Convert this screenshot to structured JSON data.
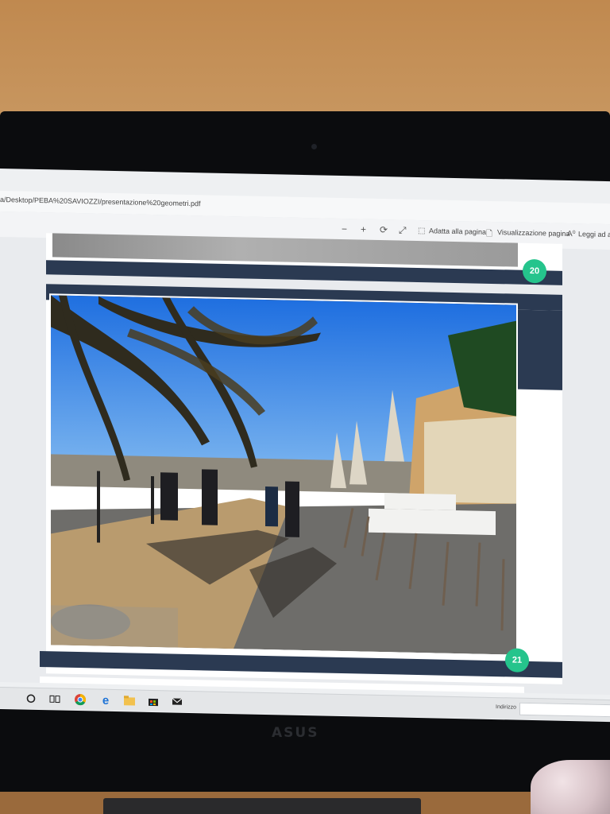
{
  "browser": {
    "address": "a/Desktop/PEBA%20SAVIOZZI/presentazione%20geometri.pdf"
  },
  "pdf_toolbar": {
    "zoom_out": "−",
    "zoom_in": "+",
    "fit_page": "Adatta alla pagina",
    "page_view": "Visualizzazione pagina",
    "read_aloud": "Leggi ad alta"
  },
  "pages": {
    "prev_number": "20",
    "current_number": "21"
  },
  "taskbar": {
    "address_label": "Indirizzo"
  },
  "laptop": {
    "brand": "ASUS"
  },
  "colors": {
    "band": "#2b3a52",
    "badge": "#25c48c"
  }
}
